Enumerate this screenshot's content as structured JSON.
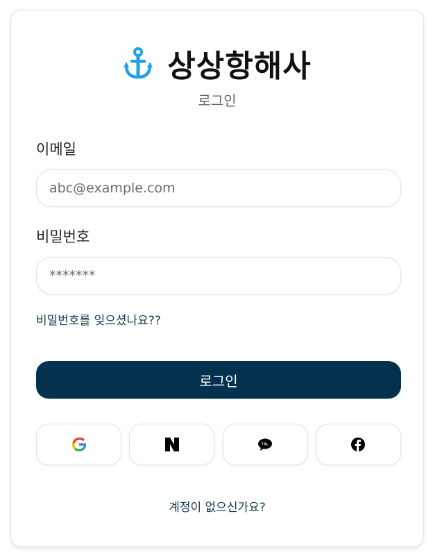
{
  "brand": {
    "name": "상상항해사",
    "icon": "anchor-icon",
    "icon_color": "#1ea2e4"
  },
  "subtitle": "로그인",
  "form": {
    "email_label": "이메일",
    "email_placeholder": "abc@example.com",
    "password_label": "비밀번호",
    "password_placeholder": "*******",
    "forgot_text": "비밀번호를 잊으셨나요??",
    "login_label": "로그인"
  },
  "social": [
    {
      "icon": "google-icon"
    },
    {
      "icon": "naver-icon"
    },
    {
      "icon": "kakao-talk-icon"
    },
    {
      "icon": "facebook-icon"
    }
  ],
  "signup_text": "계정이 없으신가요?",
  "colors": {
    "primary": "#04314f",
    "link": "#153a52"
  }
}
